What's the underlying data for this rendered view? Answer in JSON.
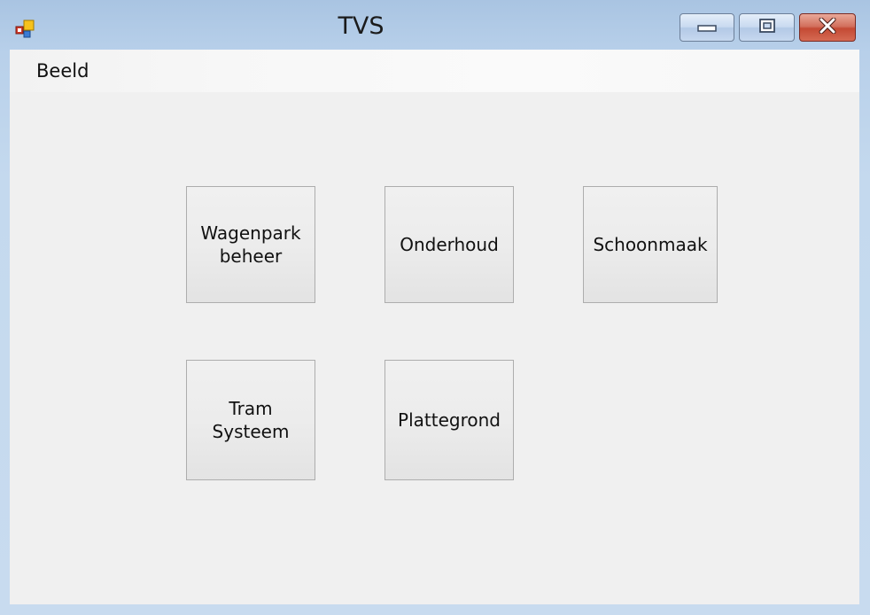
{
  "window": {
    "title": "TVS"
  },
  "caption_buttons": {
    "minimize": "minimize-icon",
    "maximize": "restore-icon",
    "close": "close-icon"
  },
  "menu": {
    "items": [
      "Beeld"
    ]
  },
  "tiles": [
    "Wagenpark\nbeheer",
    "Onderhoud",
    "Schoonmaak",
    "Tram\nSysteem",
    "Plattegrond"
  ],
  "colors": {
    "client_background": "#f0f0f0",
    "close_button": "#c44a34",
    "frame": "#b8d0ea"
  }
}
